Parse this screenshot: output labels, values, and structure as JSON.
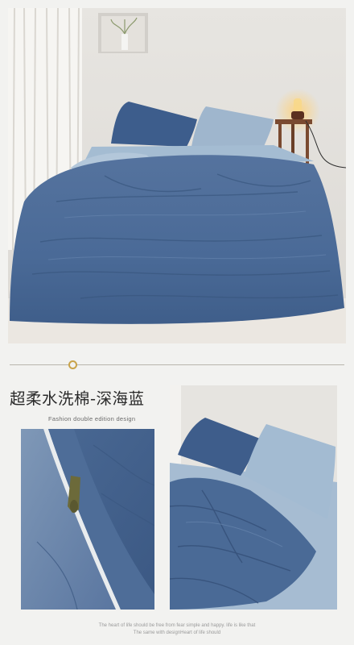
{
  "product": {
    "title": "超柔水洗棉-深海蓝",
    "subtitle": "Fashion double edition design"
  },
  "footer": {
    "line1": "The heart of life should be free from fear simple and happy. life is like that",
    "line2": "The same with designHeart of life should"
  },
  "colors": {
    "background": "#f2f2f0",
    "deep_sea_blue": "#4d6d9a",
    "light_blue": "#a9c1d6",
    "accent_gold": "#c9a34a"
  },
  "images": {
    "hero": "bed-with-deep-sea-blue-duvet-photo",
    "detail_left": "zipper-closeup-photo",
    "detail_right": "bed-corner-pillows-photo"
  }
}
